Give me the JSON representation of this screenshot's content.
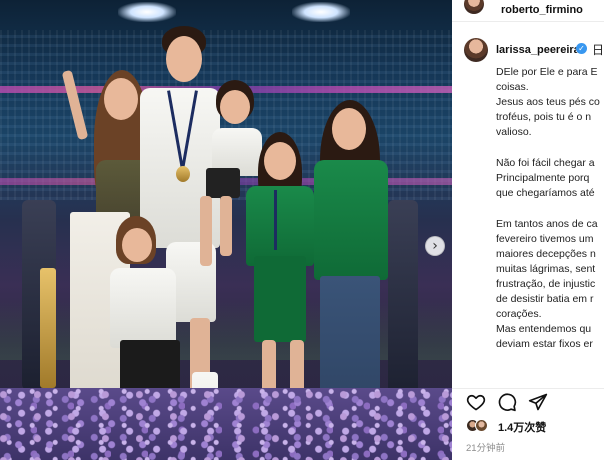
{
  "post": {
    "owner_username": "roberto_firmino",
    "carousel_next_glyph": "›"
  },
  "comment": {
    "username": "larissa_peereira",
    "verified_glyph": "✓",
    "edge_glyph": "日",
    "caption_lines": [
      "DEle por Ele e para E",
      "coisas.",
      "Jesus aos teus pés co",
      "troféus, pois tu é o n",
      "valioso.",
      "",
      "Não foi fácil chegar a",
      "Principalmente porq",
      "que chegaríamos até",
      "",
      "Em tantos anos de ca",
      "fevereiro tivemos um",
      "maiores decepções n",
      "muitas lágrimas, sent",
      "frustração, de injustic",
      "de desistir batia em r",
      "corações.",
      "Mas entendemos qu",
      "deviam estar fixos er"
    ]
  },
  "actions": {
    "like_icon": "heart-icon",
    "comment_icon": "comment-bubble-icon",
    "share_icon": "paper-plane-icon"
  },
  "likes": {
    "count_label": "1.4万次赞"
  },
  "timestamp": {
    "label": "21分钟前"
  },
  "colors": {
    "jersey_green": "#1a8a4a",
    "verified_blue": "#3897f0",
    "muted_text": "#8e8e8e"
  }
}
